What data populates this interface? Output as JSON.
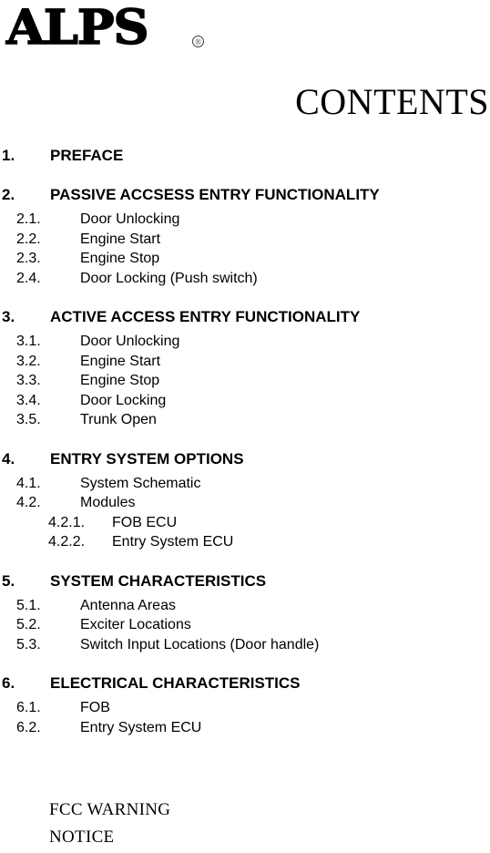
{
  "logo": {
    "wordmark": "ALPS",
    "registered_mark": "®"
  },
  "page_title": "CONTENTS",
  "toc": [
    {
      "level": 1,
      "number": "1.",
      "label": "PREFACE"
    },
    {
      "level": 1,
      "number": "2.",
      "label": "PASSIVE ACCSESS ENTRY FUNCTIONALITY"
    },
    {
      "level": 2,
      "number": "2.1.",
      "label": "Door Unlocking"
    },
    {
      "level": 2,
      "number": "2.2.",
      "label": "Engine Start"
    },
    {
      "level": 2,
      "number": "2.3.",
      "label": "Engine Stop"
    },
    {
      "level": 2,
      "number": "2.4.",
      "label": "Door Locking (Push switch)"
    },
    {
      "level": 1,
      "number": "3.",
      "label": "ACTIVE ACCESS ENTRY FUNCTIONALITY"
    },
    {
      "level": 2,
      "number": "3.1.",
      "label": "Door Unlocking"
    },
    {
      "level": 2,
      "number": "3.2.",
      "label": "Engine Start"
    },
    {
      "level": 2,
      "number": "3.3.",
      "label": "Engine Stop"
    },
    {
      "level": 2,
      "number": "3.4.",
      "label": "Door Locking"
    },
    {
      "level": 2,
      "number": "3.5.",
      "label": "Trunk Open"
    },
    {
      "level": 1,
      "number": "4.",
      "label": "ENTRY SYSTEM OPTIONS"
    },
    {
      "level": 2,
      "number": "4.1.",
      "label": "System Schematic"
    },
    {
      "level": 2,
      "number": "4.2.",
      "label": "Modules"
    },
    {
      "level": 3,
      "number": "4.2.1.",
      "label": "FOB ECU"
    },
    {
      "level": 3,
      "number": "4.2.2.",
      "label": "Entry System ECU"
    },
    {
      "level": 1,
      "number": "5.",
      "label": "SYSTEM CHARACTERISTICS"
    },
    {
      "level": 2,
      "number": "5.1.",
      "label": "Antenna Areas"
    },
    {
      "level": 2,
      "number": "5.2.",
      "label": "Exciter Locations"
    },
    {
      "level": 2,
      "number": "5.3.",
      "label": "Switch Input Locations (Door handle)"
    },
    {
      "level": 1,
      "number": "6.",
      "label": "ELECTRICAL CHARACTERISTICS"
    },
    {
      "level": 2,
      "number": "6.1.",
      "label": "FOB"
    },
    {
      "level": 2,
      "number": "6.2.",
      "label": "Entry System ECU"
    }
  ],
  "footer_notes": [
    "FCC WARNING",
    "NOTICE"
  ]
}
